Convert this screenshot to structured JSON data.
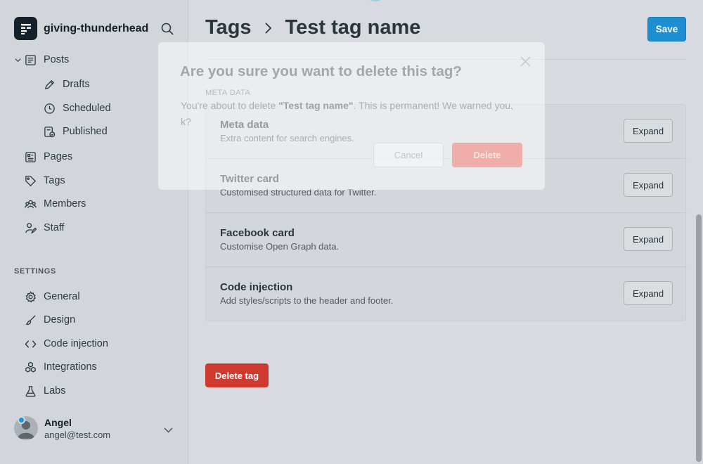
{
  "sidebar": {
    "site_name": "giving-thunderhead",
    "nav": {
      "posts": "Posts",
      "drafts": "Drafts",
      "scheduled": "Scheduled",
      "published": "Published",
      "pages": "Pages",
      "tags": "Tags",
      "members": "Members",
      "staff": "Staff"
    },
    "settings_title": "SETTINGS",
    "settings": {
      "general": "General",
      "design": "Design",
      "code_injection": "Code injection",
      "integrations": "Integrations",
      "labs": "Labs"
    },
    "user": {
      "name": "Angel",
      "email": "angel@test.com"
    }
  },
  "header": {
    "breadcrumb_parent": "Tags",
    "breadcrumb_current": "Test tag name",
    "save_label": "Save"
  },
  "main": {
    "section_label": "META DATA",
    "cards": [
      {
        "title": "Meta data",
        "desc": "Extra content for search engines.",
        "button": "Expand"
      },
      {
        "title": "Twitter card",
        "desc": "Customised structured data for Twitter.",
        "button": "Expand"
      },
      {
        "title": "Facebook card",
        "desc": "Customise Open Graph data.",
        "button": "Expand"
      },
      {
        "title": "Code injection",
        "desc": "Add styles/scripts to the header and footer.",
        "button": "Expand"
      }
    ],
    "delete_label": "Delete tag"
  },
  "modal": {
    "title": "Are you sure you want to delete this tag?",
    "text_before": "You're about to delete ",
    "text_bold": "\"Test tag name\"",
    "text_after": ". This is permanent! We warned you, k?",
    "cancel_label": "Cancel",
    "confirm_label": "Delete"
  },
  "colors": {
    "accent": "#1c8ed1",
    "danger": "#d0392e"
  }
}
